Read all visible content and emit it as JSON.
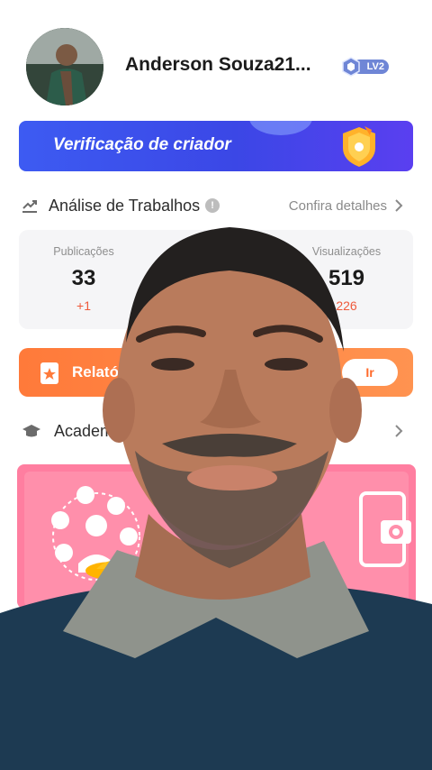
{
  "profile": {
    "name": "Anderson Souza21...",
    "level_badge": "LV2"
  },
  "verify_banner": {
    "title": "Verificação de criador"
  },
  "analysis": {
    "title": "Análise de Trabalhos",
    "info_glyph": "!",
    "details_link": "Confira detalhes",
    "stats": [
      {
        "name": "Publicações",
        "value": "33",
        "delta": "+1"
      },
      {
        "name": "Visualizações",
        "value": "519",
        "delta": "226"
      }
    ]
  },
  "report": {
    "label": "Relatór",
    "go_button": "Ir"
  },
  "academy": {
    "title": "Academ"
  },
  "icons": {
    "trend": "trend-chart-icon",
    "info": "info-icon",
    "chevron": "chevron-right-icon",
    "graduation": "graduation-cap-icon",
    "document": "document-star-icon",
    "shield": "shield-badge-icon",
    "camera": "camera-icon"
  },
  "colors": {
    "banner_blue": "#3d5bf2",
    "report_orange": "#ff7a3a",
    "academy_pink": "#ff7ea0",
    "delta_red": "#ef5a3c",
    "level_badge": "#6f86d6"
  }
}
